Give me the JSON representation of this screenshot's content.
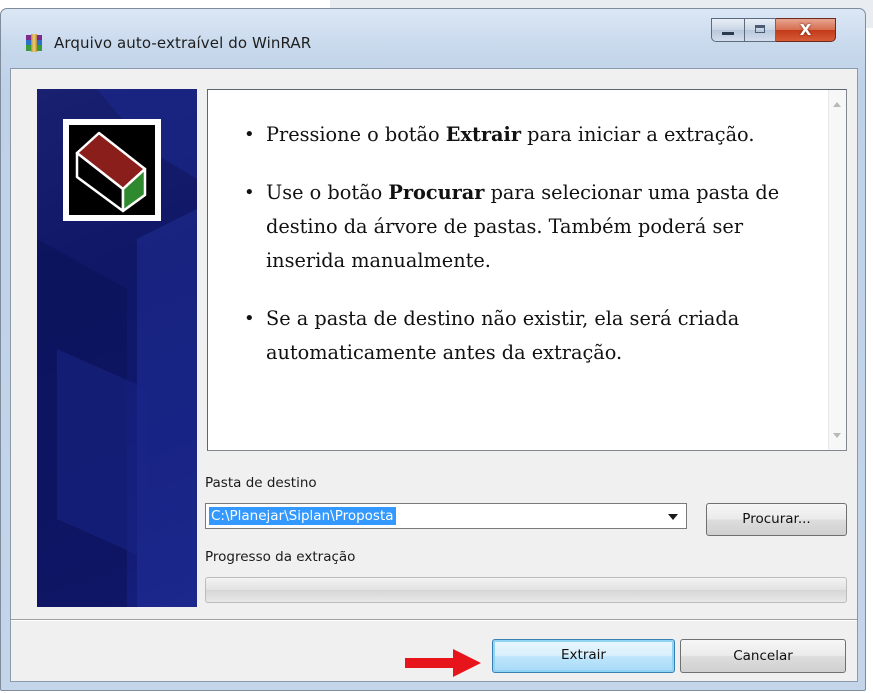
{
  "window": {
    "title": "Arquivo auto-extraível do WinRAR",
    "icon": "winrar-icon",
    "caption_buttons": [
      "minimize-icon",
      "maximize-icon",
      "close-icon"
    ],
    "close_glyph": "X"
  },
  "banner": {
    "logo": "winrar-book-logo"
  },
  "instructions": {
    "items": [
      {
        "pre": "Pressione o botão ",
        "bold": "Extrair",
        "post": " para iniciar a extração."
      },
      {
        "pre": "Use o botão ",
        "bold": "Procurar",
        "post": " para selecionar uma pasta de destino da árvore de pastas. Também poderá ser inserida manualmente."
      },
      {
        "pre": "Se a pasta de destino não existir, ela será criada automaticamente antes da extração.",
        "bold": "",
        "post": ""
      }
    ]
  },
  "destination": {
    "label": "Pasta de destino",
    "value": "C:\\Planejar\\Siplan\\Proposta"
  },
  "browse_button": "Procurar...",
  "progress": {
    "label": "Progresso da extração",
    "value": 0
  },
  "buttons": {
    "extract": "Extrair",
    "cancel": "Cancelar"
  },
  "annotation": {
    "arrow_color": "#e8141b"
  },
  "colors": {
    "banner": "#0f1766",
    "selection": "#3399ff",
    "close_button": "#c23a1a"
  }
}
